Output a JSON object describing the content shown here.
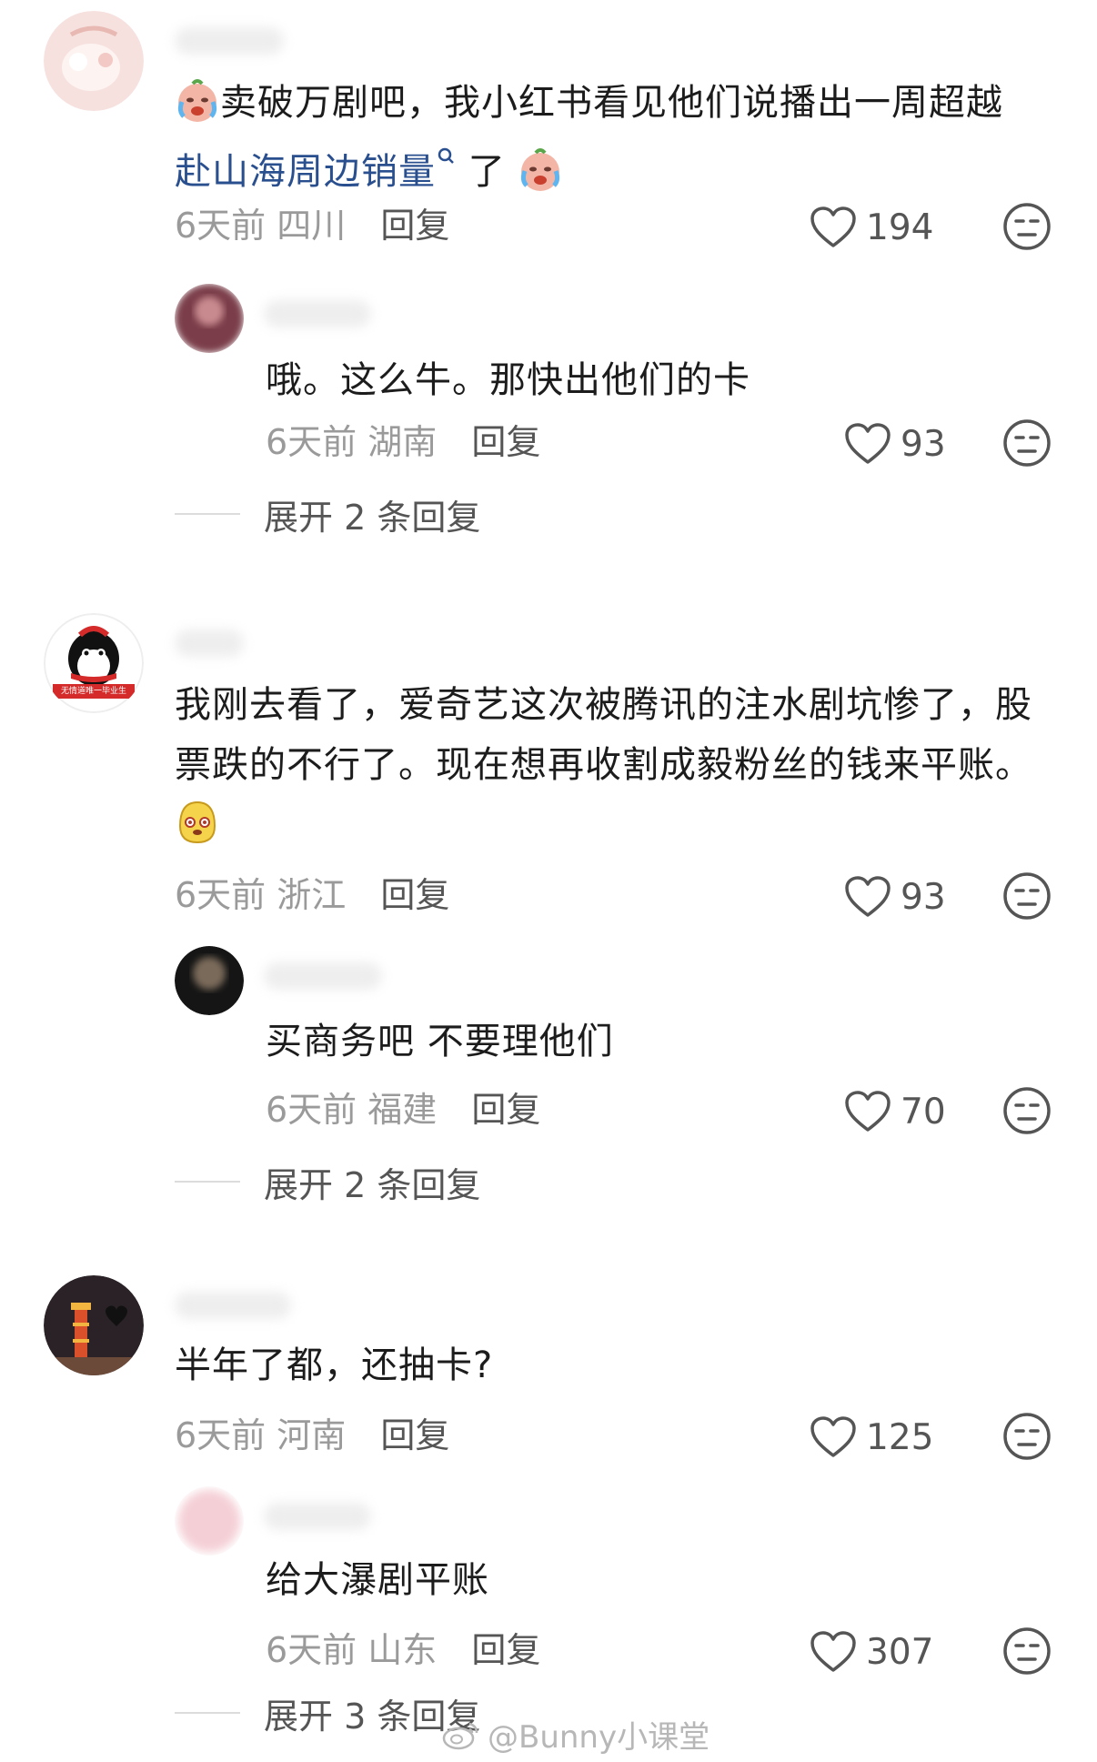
{
  "comments": [
    {
      "text_a": "卖破万剧吧，我小红书看见他们说播出一周超越",
      "link": "赴山海周边销量",
      "text_b": " 了",
      "time": "6天前",
      "location": "四川",
      "reply_label": "回复",
      "likes": "194",
      "replies": [
        {
          "text": "哦。这么牛。那快出他们的卡",
          "time": "6天前",
          "location": "湖南",
          "reply_label": "回复",
          "likes": "93"
        }
      ],
      "expand_label": "展开 2 条回复"
    },
    {
      "text": "我刚去看了，爱奇艺这次被腾讯的注水剧坑惨了，股票跌的不行了。现在想再收割成毅粉丝的钱来平账。",
      "avatar_caption": "无情道唯一毕业生",
      "time": "6天前",
      "location": "浙江",
      "reply_label": "回复",
      "likes": "93",
      "replies": [
        {
          "text": "买商务吧 不要理他们",
          "time": "6天前",
          "location": "福建",
          "reply_label": "回复",
          "likes": "70"
        }
      ],
      "expand_label": "展开 2 条回复"
    },
    {
      "text": "半年了都，还抽卡?",
      "time": "6天前",
      "location": "河南",
      "reply_label": "回复",
      "likes": "125",
      "replies": [
        {
          "text": "给大瀑剧平账",
          "time": "6天前",
          "location": "山东",
          "reply_label": "回复",
          "likes": "307"
        }
      ],
      "expand_label": "展开 3 条回复"
    }
  ],
  "watermark": "@Bunny小课堂",
  "colors": {
    "link": "#2a4f8f",
    "meta": "#9a9a9a",
    "icon": "#555555"
  }
}
